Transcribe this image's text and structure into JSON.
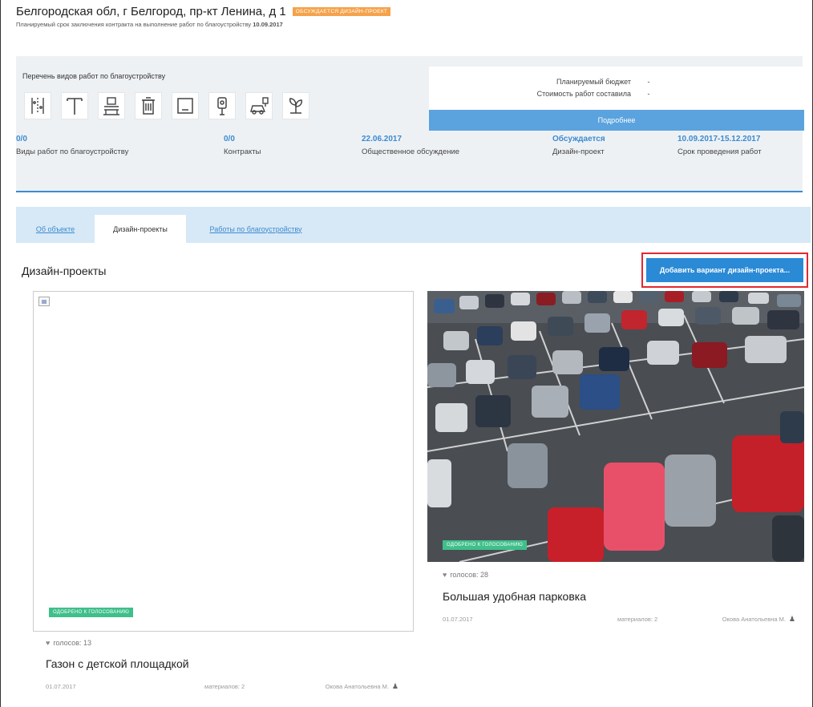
{
  "header": {
    "title": "Белгородская обл, г Белгород, пр-кт Ленина, д 1",
    "status_badge": "ОБСУЖДАЕТСЯ ДИЗАЙН-ПРОЕКТ",
    "subtitle_prefix": "Планируемый срок заключения контракта на выполнение работ по благоустройству",
    "subtitle_date": "10.09.2017"
  },
  "works": {
    "label": "Перечень видов работ по благоустройству",
    "icons": [
      "street-lamp-icon",
      "crane-icon",
      "bench-icon",
      "trash-bin-icon",
      "frame-icon",
      "lamp-post-icon",
      "car-parking-icon",
      "plant-icon"
    ]
  },
  "budget": {
    "planned_label": "Планируемый бюджет",
    "planned_value": "-",
    "cost_label": "Стоимость работ составила",
    "cost_value": "-",
    "details_button": "Подробнее"
  },
  "stats": [
    {
      "value": "0/0",
      "label": "Виды работ по благоустройству"
    },
    {
      "value": "0/0",
      "label": "Контракты"
    },
    {
      "value": "22.06.2017",
      "label": "Общественное обсуждение"
    },
    {
      "value": "Обсуждается",
      "label": "Дизайн-проект"
    },
    {
      "value": "10.09.2017-15.12.2017",
      "label": "Срок проведения работ"
    }
  ],
  "tabs": [
    {
      "label": "Об объекте",
      "active": false
    },
    {
      "label": "Дизайн-проекты",
      "active": true
    },
    {
      "label": "Работы по благоустройству",
      "active": false
    }
  ],
  "panel": {
    "title": "Дизайн-проекты",
    "add_button": "Добавить вариант дизайн-проекта..."
  },
  "cards": [
    {
      "badge": "ОДОБРЕНО К ГОЛОСОВАНИЮ",
      "votes": "голосов: 13",
      "name": "Газон с детской площадкой",
      "date": "01.07.2017",
      "materials": "материалов: 2",
      "author": "Окова Анатольевна М."
    },
    {
      "badge": "ОДОБРЕНО К ГОЛОСОВАНИЮ",
      "votes": "голосов: 28",
      "name": "Большая удобная парковка",
      "date": "01.07.2017",
      "materials": "материалов: 2",
      "author": "Окова Анатольевна М."
    }
  ],
  "colors": {
    "accent": "#2a8ad6",
    "badge_orange": "#f5a24a",
    "badge_green": "#3fbf8a",
    "highlight_red": "#e32831"
  }
}
